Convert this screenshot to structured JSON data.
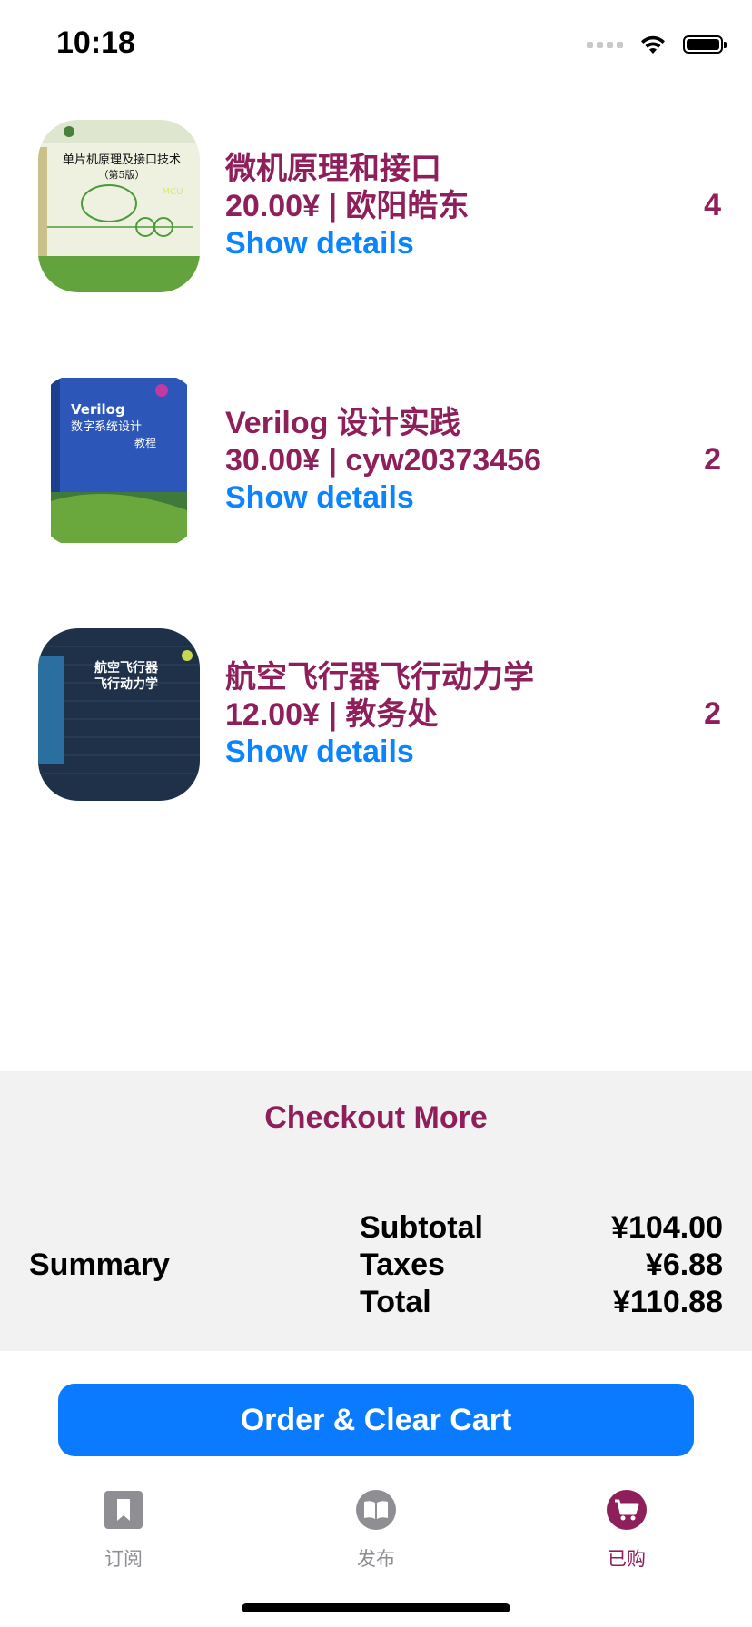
{
  "status": {
    "time": "10:18"
  },
  "items": [
    {
      "title": "微机原理和接口",
      "price_line": "20.00¥ | 欧阳皓东",
      "details": "Show details",
      "qty": "4",
      "cover": {
        "line1": "单片机原理及接口技术",
        "line2": "（第5版）",
        "tag": "MCU"
      }
    },
    {
      "title": "Verilog 设计实践",
      "price_line": "30.00¥ | cyw20373456",
      "details": "Show details",
      "qty": "2",
      "cover": {
        "line1": "Verilog",
        "line2": "数字系统设计",
        "tag": "教程"
      }
    },
    {
      "title": "航空飞行器飞行动力学",
      "price_line": "12.00¥ | 教务处",
      "details": "Show details",
      "qty": "2",
      "cover": {
        "line1": "航空飞行器",
        "line2": "飞行动力学",
        "tag": ""
      }
    }
  ],
  "checkout_more": "Checkout More",
  "summary": {
    "label": "Summary",
    "subtotal_label": "Subtotal",
    "subtotal": "¥104.00",
    "taxes_label": "Taxes",
    "taxes": "¥6.88",
    "total_label": "Total",
    "total": "¥110.88"
  },
  "order_button": "Order & Clear Cart",
  "tabs": [
    {
      "label": "订阅",
      "icon": "bookmark-icon"
    },
    {
      "label": "发布",
      "icon": "open-book-icon"
    },
    {
      "label": "已购",
      "icon": "cart-icon"
    }
  ],
  "colors": {
    "accent": "#8e1f5b",
    "link": "#0a84ff",
    "button": "#0a7bff",
    "inactive": "#8e8e93"
  }
}
